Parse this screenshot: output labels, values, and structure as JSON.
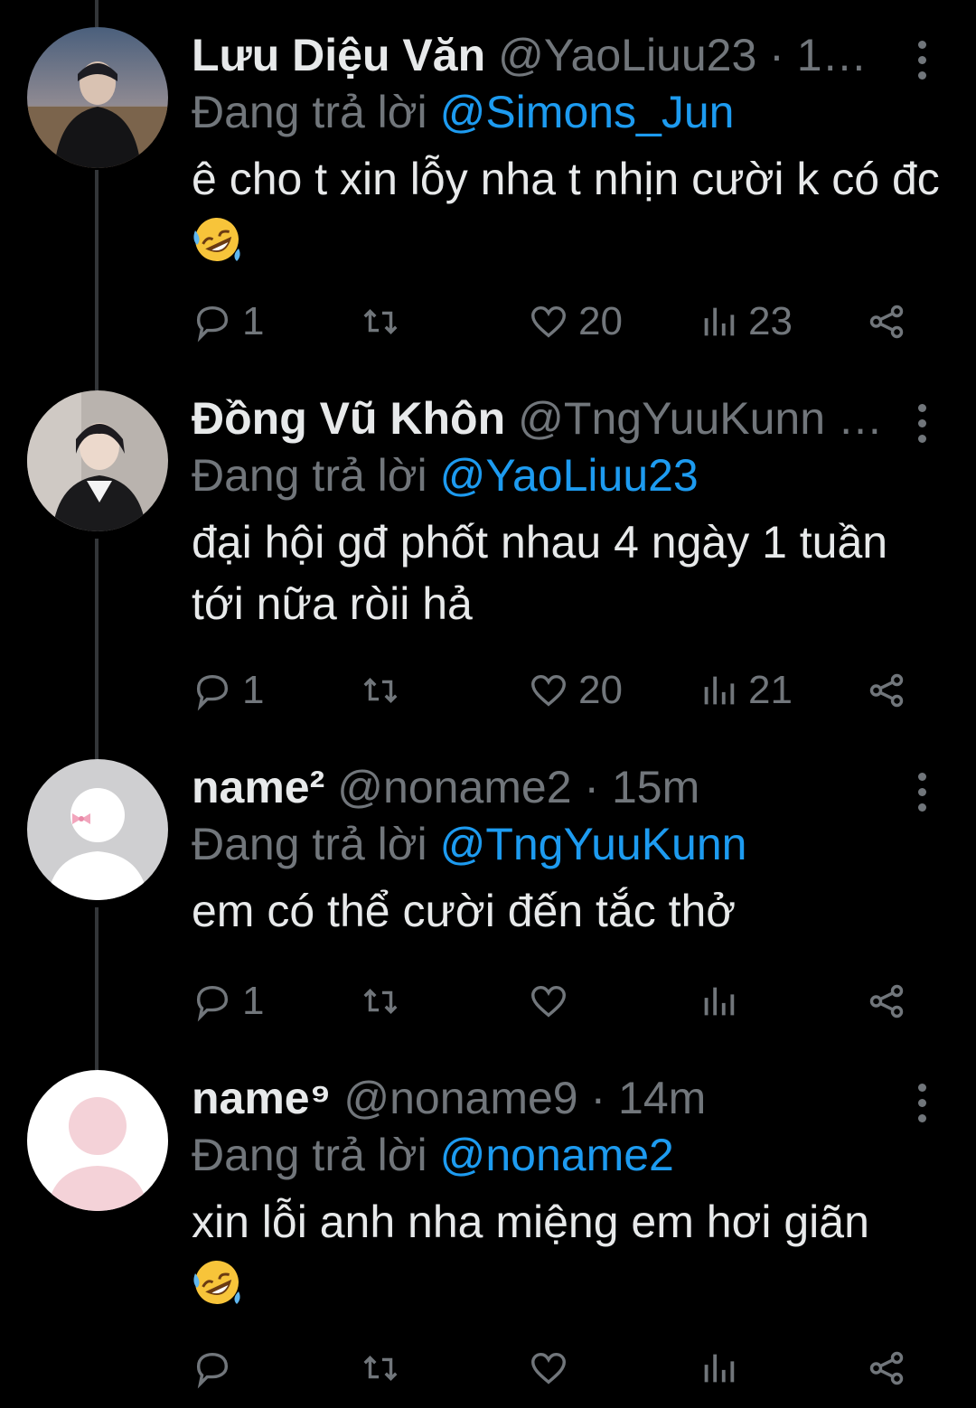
{
  "tweets": [
    {
      "name": "Lưu Diệu Văn",
      "handle_time": "@YaoLiuu23 · 1…",
      "reply_prefix": "Đang trả lời",
      "reply_to": "@Simons_Jun",
      "text": "ê cho t xin lỗy nha t nhịn cười k có đc",
      "emoji": "rolling-on-floor-laughing",
      "replies": "1",
      "retweets": "",
      "likes": "20",
      "views": "23",
      "avatar": "photo-person-desert"
    },
    {
      "name": "Đồng Vũ Khôn",
      "handle_time": "@TngYuuKunn …",
      "reply_prefix": "Đang trả lời",
      "reply_to": "@YaoLiuu23",
      "text": "đại hội gđ phốt nhau 4 ngày 1 tuần tới nữa ròii hả",
      "emoji": "",
      "replies": "1",
      "retweets": "",
      "likes": "20",
      "views": "21",
      "avatar": "photo-person-indoor"
    },
    {
      "name": "name²",
      "handle_time": "@noname2 · 15m",
      "reply_prefix": "Đang trả lời",
      "reply_to": "@TngYuuKunn",
      "text": "em có thể cười đến tắc thở",
      "emoji": "",
      "replies": "1",
      "retweets": "",
      "likes": "",
      "views": "",
      "avatar": "default-avatar-bow"
    },
    {
      "name": "name⁹",
      "handle_time": "@noname9 · 14m",
      "reply_prefix": "Đang trả lời",
      "reply_to": "@noname2",
      "text": "xin lỗi anh nha miệng em hơi giãn",
      "emoji": "rolling-on-floor-laughing",
      "replies": "",
      "retweets": "",
      "likes": "",
      "views": "",
      "avatar": "default-avatar-pink"
    }
  ],
  "colors": {
    "background": "#000000",
    "text": "#e7e9ea",
    "muted": "#71767b",
    "accent": "#1d9bf0",
    "thread_line": "#333639"
  }
}
